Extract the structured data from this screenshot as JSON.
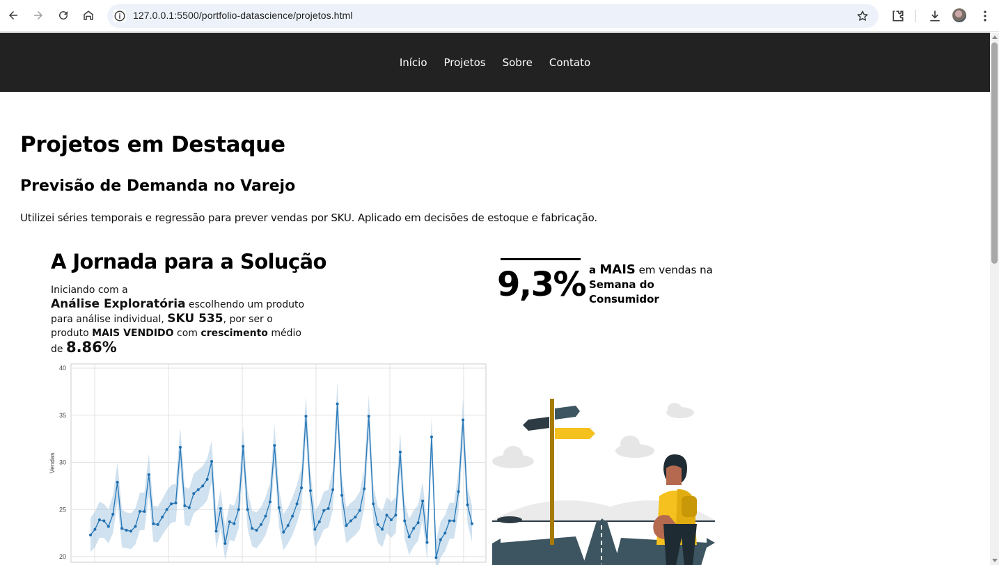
{
  "browser": {
    "url": "127.0.0.1:5500/portfolio-datascience/projetos.html"
  },
  "nav": {
    "items": [
      "Início",
      "Projetos",
      "Sobre",
      "Contato"
    ]
  },
  "page": {
    "title": "Projetos em Destaque",
    "project_title": "Previsão de Demanda no Varejo",
    "project_desc": "Utilizei séries temporais e regressão para prever vendas por SKU. Aplicado em decisões de estoque e fabricação."
  },
  "infographic": {
    "title": "A Jornada para a Solução",
    "t1": "Iniciando com a",
    "t2": "Análise Exploratória",
    "t3": " escolhendo um produto para análise individual, ",
    "t4": "SKU 535",
    "t5": ", por ser o produto ",
    "t6": "MAIS VENDIDO",
    "t7": " com ",
    "t8": "crescimento",
    "t9": " médio de ",
    "t10": "8.86%",
    "stat_value": "9,3%",
    "stat_a": "a ",
    "stat_mais": "MAIS",
    "stat_em": " em vendas na ",
    "stat_semana": "Semana do Consumidor"
  },
  "chart_data": {
    "type": "line",
    "ylabel": "Vendas",
    "xlabel": "",
    "ylim": [
      20,
      40
    ],
    "yticks": [
      20,
      25,
      30,
      35,
      40
    ],
    "grid": true,
    "series": [
      {
        "values": [
          22.3,
          22.9,
          23.9,
          23.8,
          23.2,
          24.5,
          27.9,
          23.0,
          22.8,
          22.7,
          23.2,
          24.8,
          24.8,
          28.7,
          23.5,
          23.4,
          24.2,
          25.0,
          25.6,
          25.7,
          31.6,
          25.4,
          25.2,
          26.7,
          27.1,
          27.5,
          28.2,
          30.1,
          22.7,
          25.1,
          21.4,
          23.7,
          23.5,
          25.0,
          31.7,
          25.0,
          23.0,
          22.8,
          23.4,
          24.3,
          25.8,
          31.8,
          25.2,
          22.6,
          23.3,
          24.3,
          25.6,
          27.3,
          34.9,
          27.0,
          22.9,
          23.7,
          24.9,
          25.1,
          27.1,
          36.2,
          26.5,
          23.3,
          23.8,
          24.2,
          24.9,
          27.2,
          34.9,
          25.6,
          23.4,
          22.9,
          24.4,
          23.9,
          24.4,
          31.1,
          23.8,
          22.1,
          23.0,
          23.6,
          25.9,
          21.5,
          32.7,
          19.9,
          21.8,
          22.5,
          23.8,
          23.8,
          26.9,
          34.5,
          25.5,
          23.5
        ],
        "lower": [
          20.5,
          21.0,
          22.0,
          22.0,
          21.4,
          22.5,
          25.8,
          21.0,
          20.9,
          20.8,
          21.3,
          22.8,
          22.8,
          26.5,
          21.6,
          21.5,
          22.3,
          23.0,
          23.6,
          23.7,
          29.5,
          23.4,
          23.2,
          24.6,
          25.0,
          25.4,
          26.0,
          27.9,
          20.8,
          23.1,
          19.6,
          21.8,
          21.6,
          23.0,
          29.6,
          23.0,
          21.1,
          20.9,
          21.5,
          22.3,
          23.8,
          29.6,
          23.2,
          20.7,
          21.4,
          22.3,
          23.6,
          25.2,
          32.7,
          24.9,
          21.0,
          21.8,
          22.9,
          23.1,
          25.0,
          33.9,
          24.4,
          21.4,
          21.9,
          22.3,
          22.9,
          25.1,
          32.6,
          23.6,
          21.5,
          21.0,
          22.5,
          22.0,
          22.5,
          29.0,
          21.9,
          20.2,
          21.1,
          21.7,
          23.9,
          19.6,
          30.5,
          18.1,
          19.9,
          20.6,
          21.9,
          21.9,
          24.8,
          32.2,
          23.5,
          21.6
        ],
        "upper": [
          24.1,
          24.8,
          25.8,
          25.6,
          25.0,
          26.5,
          30.0,
          25.0,
          24.7,
          24.6,
          25.1,
          26.8,
          26.8,
          30.9,
          25.4,
          25.3,
          26.1,
          27.0,
          27.6,
          27.7,
          33.7,
          27.4,
          27.2,
          28.8,
          29.2,
          29.6,
          30.4,
          32.3,
          24.6,
          27.1,
          23.2,
          25.6,
          25.4,
          27.0,
          33.8,
          27.0,
          24.9,
          24.7,
          25.3,
          26.3,
          27.8,
          34.0,
          27.2,
          24.5,
          25.2,
          26.3,
          27.6,
          29.4,
          37.1,
          29.1,
          24.8,
          25.6,
          26.9,
          27.1,
          29.2,
          38.5,
          28.6,
          25.2,
          25.7,
          26.1,
          26.9,
          29.3,
          37.2,
          27.6,
          25.3,
          24.8,
          26.3,
          25.8,
          26.3,
          33.2,
          25.7,
          24.0,
          24.9,
          25.5,
          27.9,
          23.4,
          34.9,
          21.7,
          23.7,
          24.4,
          25.7,
          25.7,
          29.0,
          36.8,
          27.5,
          25.4
        ]
      }
    ]
  }
}
